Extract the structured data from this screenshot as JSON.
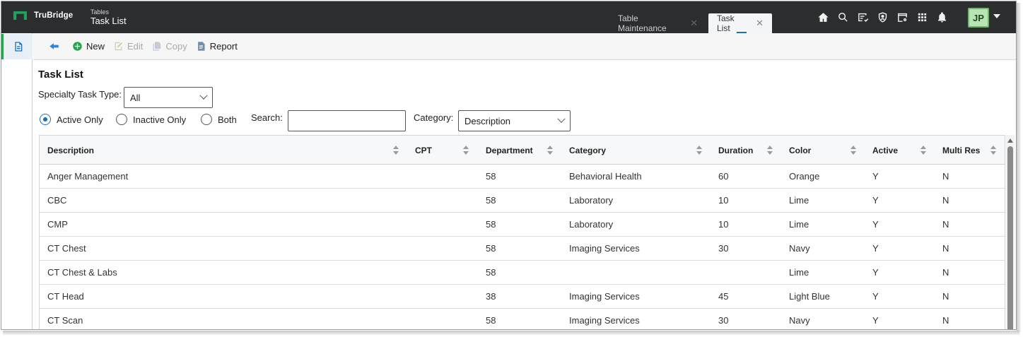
{
  "app": {
    "brand": "TruBridge",
    "breadcrumb_section": "Tables",
    "breadcrumb_title": "Task List",
    "accent_color": "#2aa14f",
    "topbar_color": "#2b2d2f"
  },
  "tabs": [
    {
      "label": "Table Maintenance",
      "active": false
    },
    {
      "label": "Task List",
      "active": true
    }
  ],
  "header_icons": [
    "home-icon",
    "search-icon",
    "checklist-icon",
    "shield-icon",
    "calendar-settings-icon",
    "apps-grid-icon",
    "bell-icon"
  ],
  "user": {
    "initials": "JP"
  },
  "toolbar": {
    "new_label": "New",
    "edit_label": "Edit",
    "copy_label": "Copy",
    "report_label": "Report"
  },
  "page": {
    "title": "Task List",
    "specialty_label": "Specialty Task Type:",
    "specialty_value": "All",
    "radio_active": "Active Only",
    "radio_inactive": "Inactive Only",
    "radio_both": "Both",
    "search_label": "Search:",
    "search_value": "",
    "category_label": "Category:",
    "category_value": "Description"
  },
  "table": {
    "columns": [
      "Description",
      "CPT",
      "Department",
      "Category",
      "Duration",
      "Color",
      "Active",
      "Multi Res"
    ],
    "rows": [
      {
        "description": "Anger Management",
        "cpt": "",
        "department": "58",
        "category": "Behavioral Health",
        "duration": "60",
        "color": "Orange",
        "active": "Y",
        "multi_res": "N"
      },
      {
        "description": "CBC",
        "cpt": "",
        "department": "58",
        "category": "Laboratory",
        "duration": "10",
        "color": "Lime",
        "active": "Y",
        "multi_res": "N"
      },
      {
        "description": "CMP",
        "cpt": "",
        "department": "58",
        "category": "Laboratory",
        "duration": "10",
        "color": "Lime",
        "active": "Y",
        "multi_res": "N"
      },
      {
        "description": "CT Chest",
        "cpt": "",
        "department": "58",
        "category": "Imaging Services",
        "duration": "30",
        "color": "Navy",
        "active": "Y",
        "multi_res": "N"
      },
      {
        "description": "CT Chest & Labs",
        "cpt": "",
        "department": "58",
        "category": "",
        "duration": "",
        "color": "Lime",
        "active": "Y",
        "multi_res": "N"
      },
      {
        "description": "CT Head",
        "cpt": "",
        "department": "38",
        "category": "Imaging Services",
        "duration": "45",
        "color": "Light Blue",
        "active": "Y",
        "multi_res": "N"
      },
      {
        "description": "CT Scan",
        "cpt": "",
        "department": "58",
        "category": "Imaging Services",
        "duration": "30",
        "color": "Navy",
        "active": "Y",
        "multi_res": "N"
      }
    ]
  }
}
